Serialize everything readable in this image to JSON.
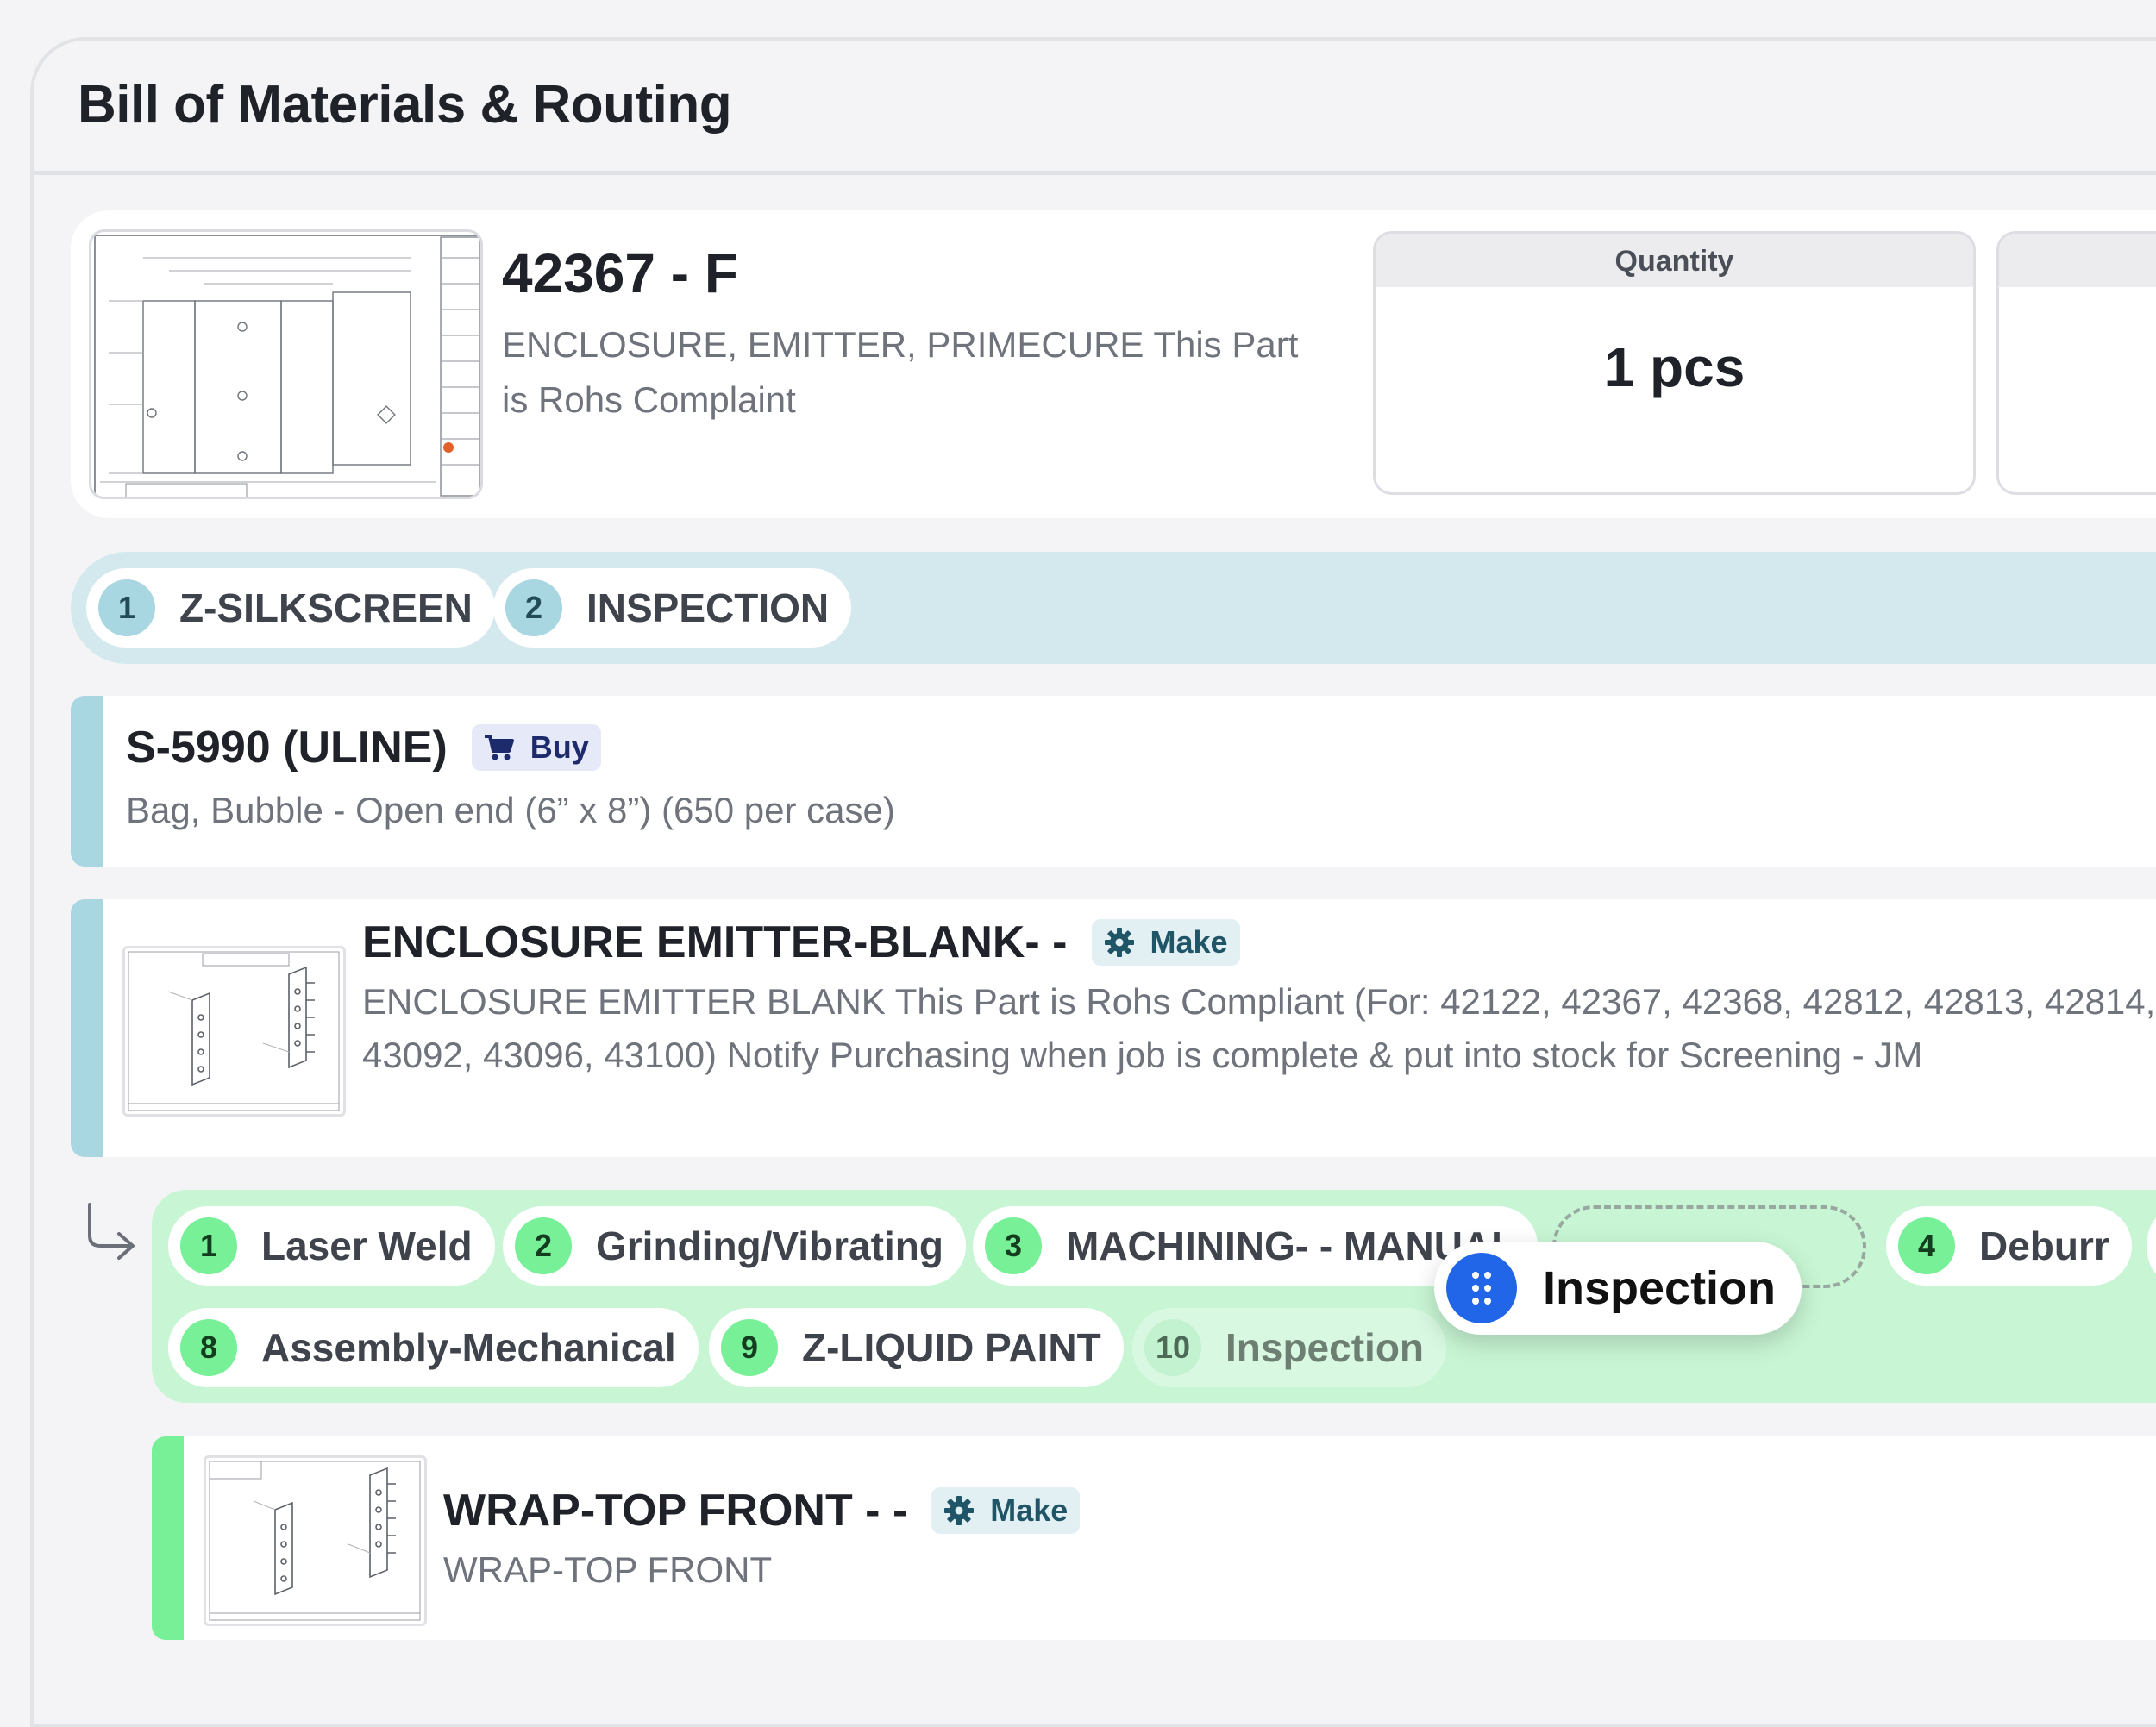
{
  "page": {
    "title": "Bill of Materials & Routing"
  },
  "part": {
    "number": "42367 - F",
    "description": "ENCLOSURE, EMITTER, PRIMECURE This Part is Rohs Complaint",
    "quantity_label": "Quantity",
    "quantity_value": "1 pcs"
  },
  "top_routing": [
    {
      "num": "1",
      "label": "Z-SILKSCREEN"
    },
    {
      "num": "2",
      "label": "INSPECTION"
    }
  ],
  "items": [
    {
      "title": "S-5990 (ULINE)",
      "badge": "Buy",
      "description": "Bag, Bubble - Open end (6” x 8”) (650 per case)"
    },
    {
      "title": "ENCLOSURE EMITTER-BLANK- -",
      "badge": "Make",
      "description": "ENCLOSURE EMITTER BLANK This Part is Rohs Compliant (For: 42122, 42367, 42368, 42812, 42813, 42814, 43092, 43096, 43100) Notify Purchasing when job is complete & put into stock for Screening - JM"
    },
    {
      "title": "WRAP-TOP FRONT - -",
      "badge": "Make",
      "description": "WRAP-TOP FRONT"
    }
  ],
  "sub_routing": {
    "row1": [
      {
        "num": "1",
        "label": "Laser Weld"
      },
      {
        "num": "2",
        "label": "Grinding/Vibrating"
      },
      {
        "num": "3",
        "label": "MACHINING- - MANUAL"
      },
      {
        "num": "4",
        "label": "Deburr"
      }
    ],
    "row2": [
      {
        "num": "8",
        "label": "Assembly-Mechanical"
      },
      {
        "num": "9",
        "label": "Z-LIQUID PAINT"
      },
      {
        "num": "10",
        "label": "Inspection"
      }
    ],
    "dragging": {
      "label": "Inspection"
    }
  },
  "colors": {
    "accent_blue": "#a8d6e1",
    "accent_green": "#78f097",
    "drag_handle": "#2166e8"
  }
}
